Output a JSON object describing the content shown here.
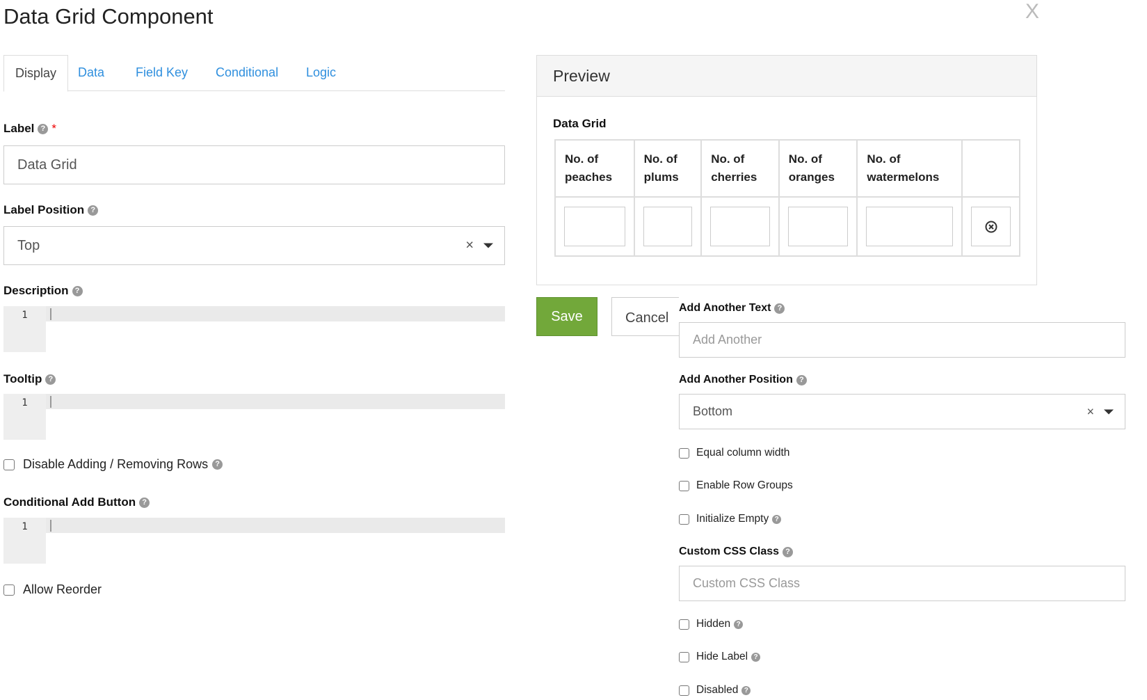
{
  "title": "Data Grid Component",
  "close_label": "X",
  "tabs": [
    {
      "label": "Display"
    },
    {
      "label": "Data"
    },
    {
      "label": "Field Key"
    },
    {
      "label": "Conditional"
    },
    {
      "label": "Logic"
    }
  ],
  "left": {
    "label": {
      "label": "Label",
      "required": "*",
      "value": "Data Grid"
    },
    "label_position": {
      "label": "Label Position",
      "value": "Top"
    },
    "description": {
      "label": "Description",
      "line": "1"
    },
    "tooltip": {
      "label": "Tooltip",
      "line": "1"
    },
    "disable_adding": {
      "label": "Disable Adding / Removing Rows"
    },
    "conditional_add": {
      "label": "Conditional Add Button",
      "line": "1"
    },
    "allow_reorder": {
      "label": "Allow Reorder"
    }
  },
  "preview": {
    "title": "Preview",
    "grid_label": "Data Grid",
    "columns": [
      "No. of peaches",
      "No. of plums",
      "No. of cherries",
      "No. of oranges",
      "No. of watermelons"
    ]
  },
  "buttons": {
    "save": "Save",
    "cancel": "Cancel"
  },
  "right": {
    "add_another_text": {
      "label": "Add Another Text",
      "placeholder": "Add Another"
    },
    "add_another_position": {
      "label": "Add Another Position",
      "value": "Bottom"
    },
    "equal_column_width": "Equal column width",
    "enable_row_groups": "Enable Row Groups",
    "initialize_empty": "Initialize Empty",
    "custom_css": {
      "label": "Custom CSS Class",
      "placeholder": "Custom CSS Class"
    },
    "hidden": "Hidden",
    "hide_label": "Hide Label",
    "disabled": "Disabled"
  },
  "colors": {
    "accent": "#2f8fde",
    "save": "#72a83a",
    "required": "#e00000"
  },
  "icons": {
    "help": "question-circle",
    "remove_row": "times-circle",
    "clear": "times",
    "dropdown": "caret-down"
  }
}
